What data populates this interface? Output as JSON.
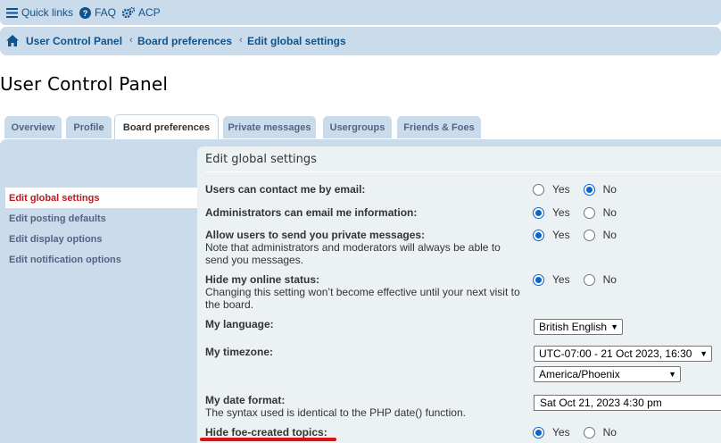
{
  "topnav": {
    "quick_links": "Quick links",
    "faq": "FAQ",
    "acp": "ACP"
  },
  "breadcrumbs": {
    "home_icon": "home-icon",
    "items": [
      "User Control Panel",
      "Board preferences",
      "Edit global settings"
    ],
    "separator": "‹"
  },
  "page_title": "User Control Panel",
  "tabs": [
    "Overview",
    "Profile",
    "Board preferences",
    "Private messages",
    "Usergroups",
    "Friends & Foes"
  ],
  "active_tab": "Board preferences",
  "menu": [
    "Edit global settings",
    "Edit posting defaults",
    "Edit display options",
    "Edit notification options"
  ],
  "section_title": "Edit global settings",
  "yes_label": "Yes",
  "no_label": "No",
  "settings": {
    "contact_email": {
      "label": "Users can contact me by email:",
      "value": "No"
    },
    "admin_email": {
      "label": "Administrators can email me information:",
      "value": "Yes"
    },
    "private_msgs": {
      "label": "Allow users to send you private messages:",
      "note": "Note that administrators and moderators will always be able to send you messages.",
      "value": "Yes"
    },
    "hide_online": {
      "label": "Hide my online status:",
      "note": "Changing this setting won’t become effective until your next visit to the board.",
      "value": "Yes"
    },
    "language": {
      "label": "My language:",
      "value": "British English"
    },
    "timezone": {
      "label": "My timezone:",
      "value": "UTC-07:00 - 21 Oct 2023, 16:30",
      "zone": "America/Phoenix"
    },
    "date_format": {
      "label": "My date format:",
      "note_prefix": "The syntax used is identical to the PHP",
      "note_link": "date()",
      "note_suffix": "function.",
      "value": "Sat Oct 21, 2023 4:30 pm"
    },
    "hide_foe": {
      "label": "Hide foe-created topics:",
      "value": "Yes"
    }
  },
  "colors": {
    "nav_bg": "#cadceb",
    "content_bg": "#ecf1f3",
    "link": "#105289",
    "active_menu": "#ba1b1b",
    "highlight_underline": "#e01010"
  }
}
